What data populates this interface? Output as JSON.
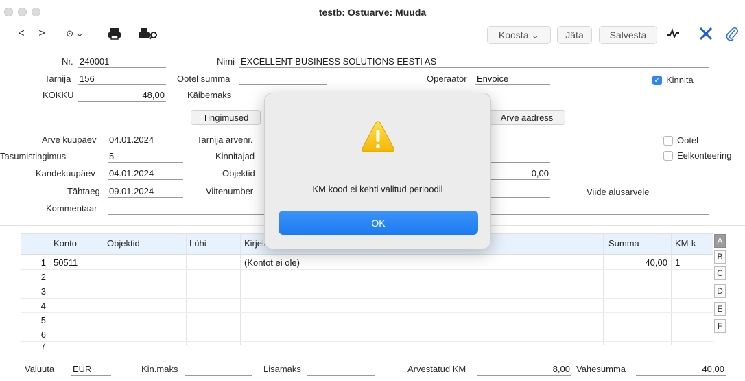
{
  "window": {
    "title": "testb: Ostuarve: Muuda"
  },
  "toolbar": {
    "back": "<",
    "forward": ">",
    "more": "⊙ ⌄",
    "koosta": "Koosta ⌄",
    "jata": "Jäta",
    "salvesta": "Salvesta"
  },
  "header": {
    "nr_label": "Nr.",
    "nr": "240001",
    "nimi_label": "Nimi",
    "nimi": "EXCELLENT BUSINESS SOLUTIONS EESTI AS",
    "tarnija_label": "Tarnija",
    "tarnija": "156",
    "ootel_summa_label": "Ootel summa",
    "ootel_summa": "",
    "operaator_label": "Operaator",
    "operaator": "Envoice",
    "kinnita_label": "Kinnita",
    "kokku_label": "KOKKU",
    "kokku": "48,00",
    "kaibemaks_label": "Käibemaks",
    "tingimused": "Tingimused",
    "arve_aadress": "Arve aadress",
    "arve_kuupaev_label": "Arve kuupäev",
    "arve_kuupaev": "04.01.2024",
    "tarnija_arvenr_label": "Tarnija arvenr.",
    "ootel_label": "Ootel",
    "tasumistingimus_label": "Tasumistingimus",
    "tasumistingimus": "5",
    "kinnitajad_label": "Kinnitajad",
    "eelkonteering_label": "Eelkonteering",
    "kandekuupaev_label": "Kandekuupäev",
    "kandekuupaev": "04.01.2024",
    "objektid_label": "Objektid",
    "summa_field": "0,00",
    "tahtaeg_label": "Tähtaeg",
    "tahtaeg": "09.01.2024",
    "viitenumber_label": "Viitenumber",
    "viide_label": "Viide alusarvele",
    "kommentaar_label": "Kommentaar"
  },
  "grid": {
    "columns": [
      "Konto",
      "Objektid",
      "Lühi",
      "Kirjeldus",
      "Summa",
      "KM-k"
    ],
    "rows": [
      {
        "n": "1",
        "konto": "50511",
        "kirjeldus": "(Kontot ei ole)",
        "summa": "40,00",
        "kmk": "1"
      },
      {
        "n": "2",
        "konto": "",
        "kirjeldus": "",
        "summa": "",
        "kmk": ""
      },
      {
        "n": "3",
        "konto": "",
        "kirjeldus": "",
        "summa": "",
        "kmk": ""
      },
      {
        "n": "4",
        "konto": "",
        "kirjeldus": "",
        "summa": "",
        "kmk": ""
      },
      {
        "n": "5",
        "konto": "",
        "kirjeldus": "",
        "summa": "",
        "kmk": ""
      },
      {
        "n": "6",
        "konto": "",
        "kirjeldus": "",
        "summa": "",
        "kmk": ""
      },
      {
        "n": "7",
        "konto": "",
        "kirjeldus": "",
        "summa": "",
        "kmk": ""
      }
    ],
    "side_tabs": [
      "A",
      "B",
      "C",
      "D",
      "E",
      "F"
    ]
  },
  "footer": {
    "valuuta_label": "Valuuta",
    "valuuta": "EUR",
    "kinmaks_label": "Kin.maks",
    "lisamaks_label": "Lisamaks",
    "arvestatud_km_label": "Arvestatud KM",
    "arvestatud_km": "8,00",
    "vahesumma_label": "Vahesumma",
    "vahesumma": "40,00"
  },
  "dialog": {
    "message": "KM kood ei kehti valitud perioodil",
    "ok": "OK"
  },
  "colors": {
    "accent": "#1c7bf1",
    "warning": "#f5c518",
    "grid_header": "#e8f2fc"
  }
}
